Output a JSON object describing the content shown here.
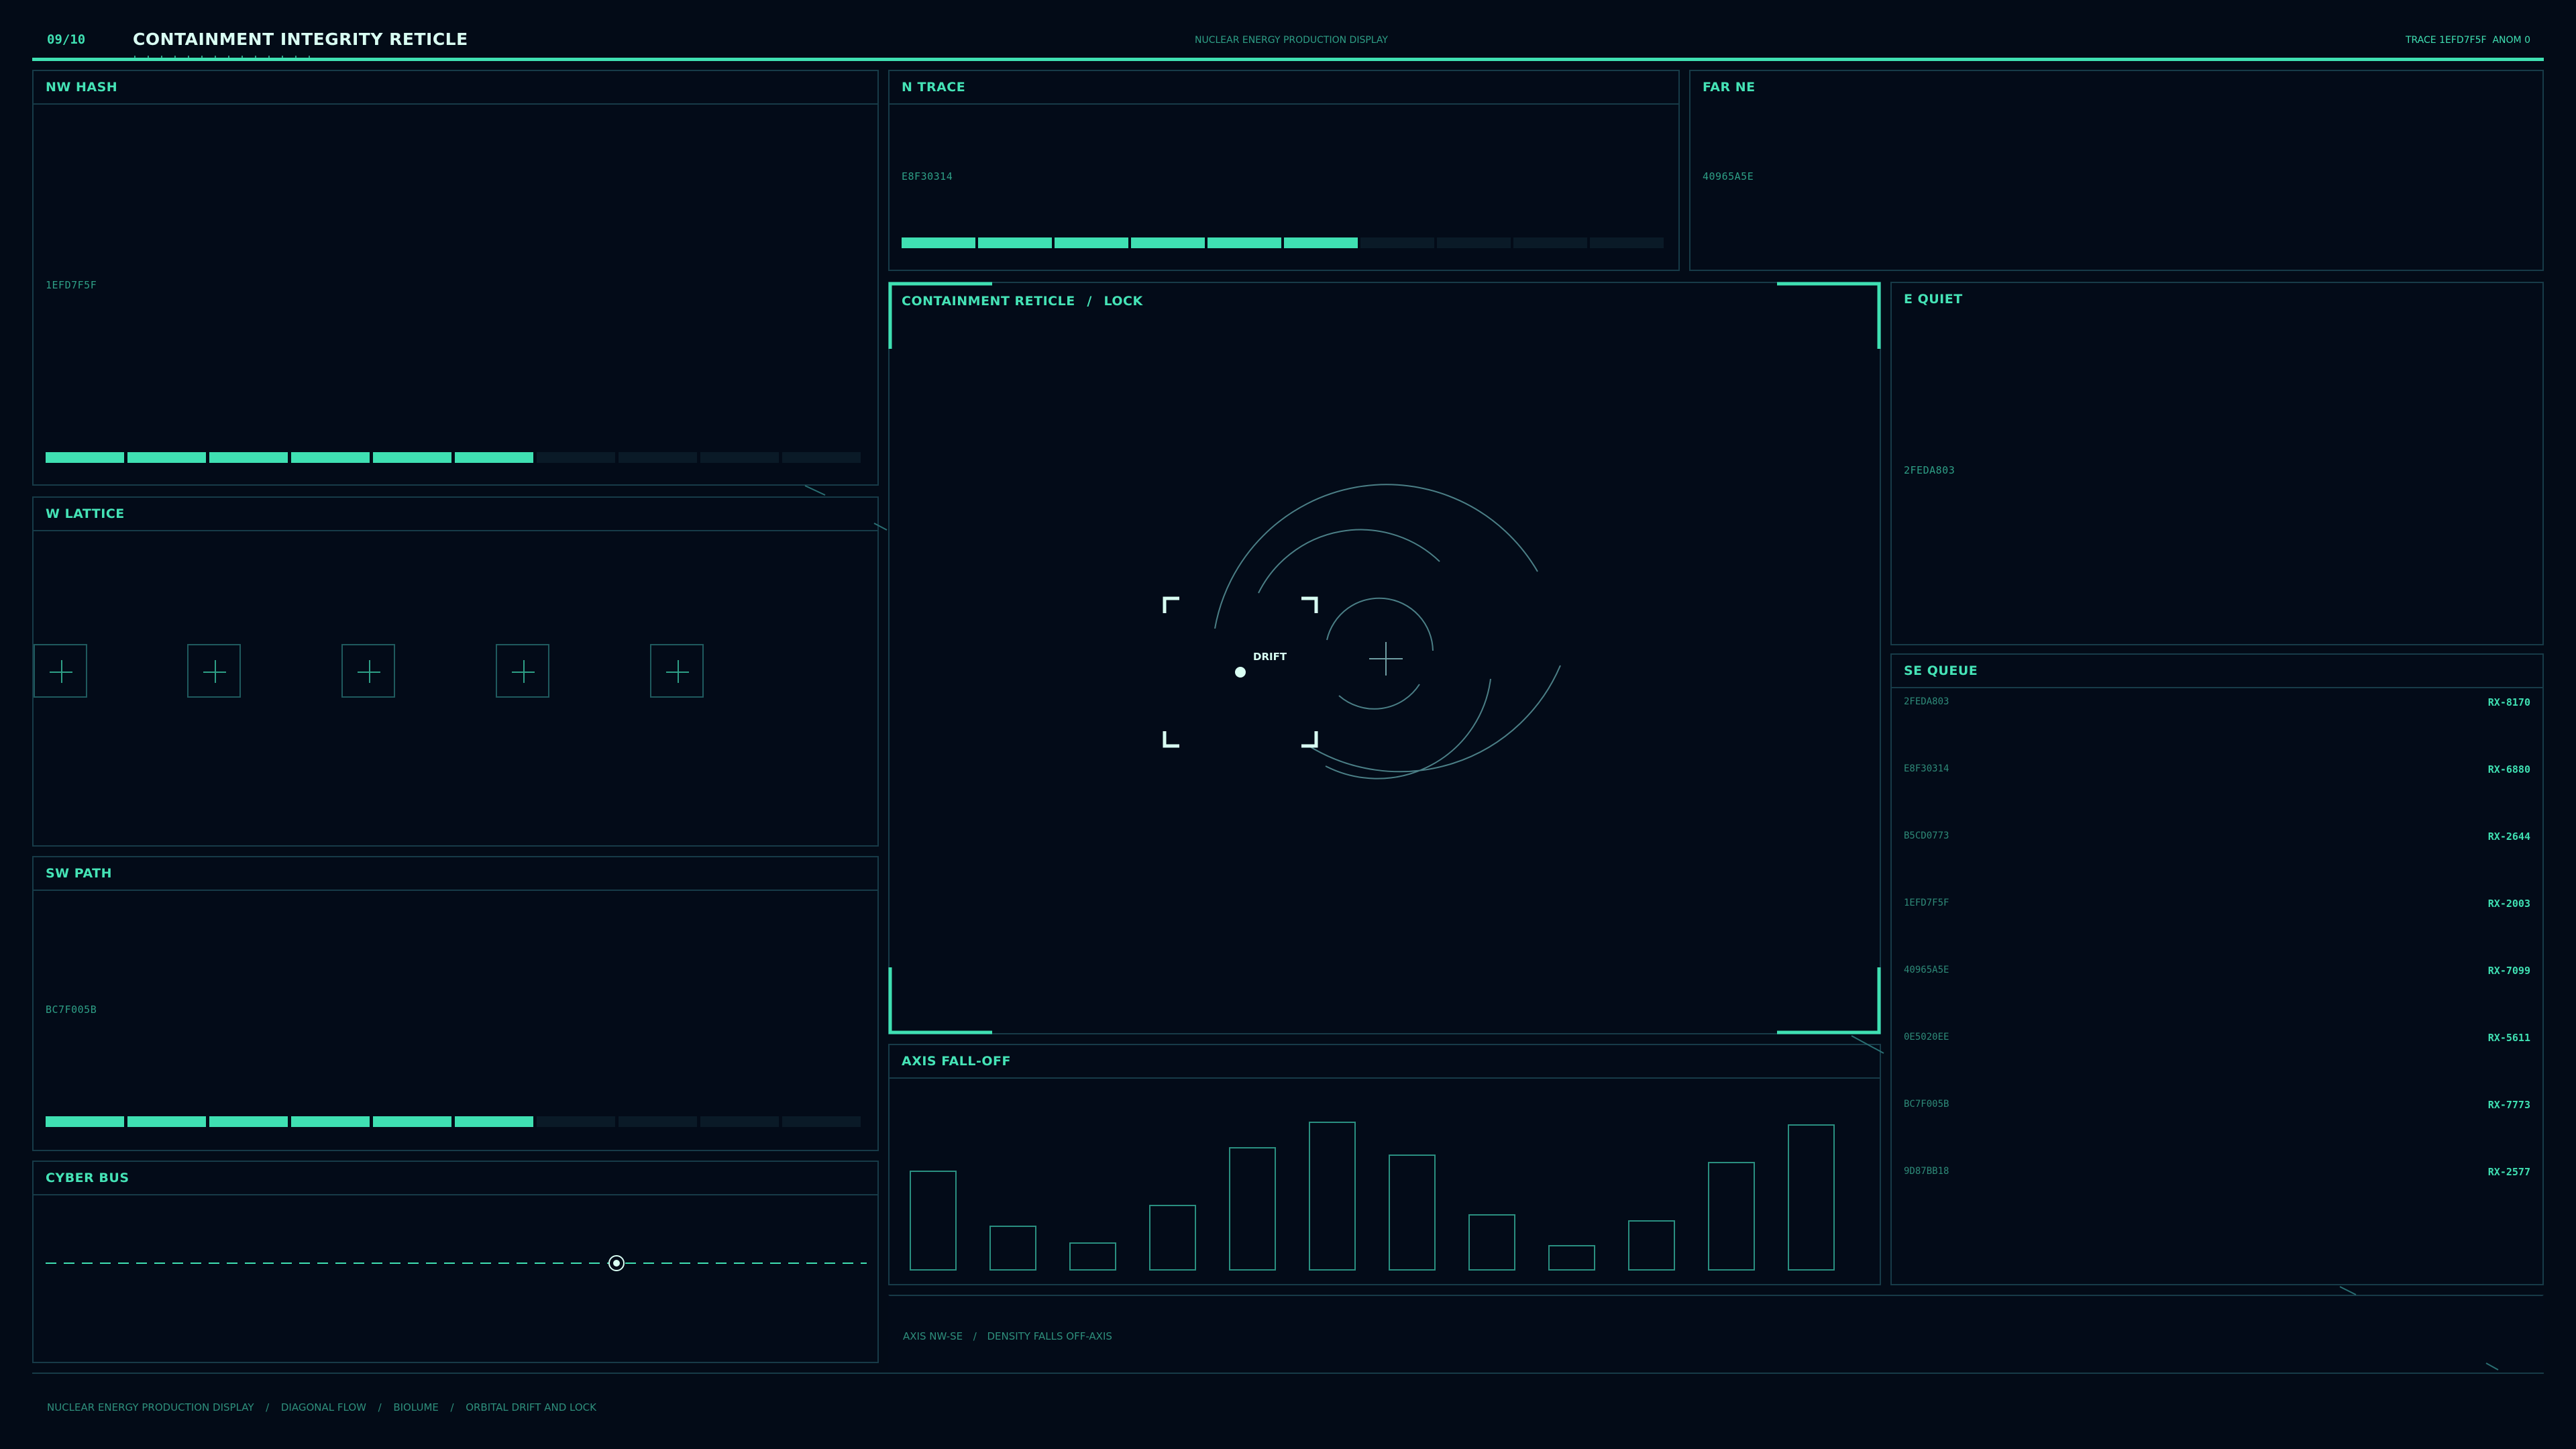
{
  "header": {
    "page_counter": "09/10",
    "title": "CONTAINMENT INTEGRITY RETICLE",
    "subtitle": "NUCLEAR ENERGY PRODUCTION DISPLAY",
    "trace": "TRACE 1EFD7F5F",
    "anom": "ANOM 0"
  },
  "panels": {
    "nw_hash": {
      "title": "NW HASH",
      "hex": "1EFD7F5F",
      "level": 0.6
    },
    "n_trace": {
      "title": "N TRACE",
      "hex": "E8F30314",
      "level": 0.6
    },
    "far_ne": {
      "title": "FAR NE",
      "hex": "40965A5E"
    },
    "w_lattice": {
      "title": "W LATTICE",
      "cells": 5
    },
    "sw_path": {
      "title": "SW PATH",
      "hex": "BC7F005B",
      "level": 0.6
    },
    "cyber_bus": {
      "title": "CYBER BUS",
      "marker_position": 0.7
    },
    "e_quiet": {
      "title": "E QUIET",
      "hex": "2FEDA803"
    },
    "reticle": {
      "title_a": "CONTAINMENT RETICLE",
      "sep": "/",
      "title_b": "LOCK",
      "drift_label": "DRIFT"
    },
    "axis_falloff": {
      "title": "AXIS FALL-OFF"
    }
  },
  "se_queue": {
    "title": "SE QUEUE",
    "rows": [
      {
        "id": "2FEDA803",
        "code": "RX-8170"
      },
      {
        "id": "E8F30314",
        "code": "RX-6880"
      },
      {
        "id": "B5CD0773",
        "code": "RX-2644"
      },
      {
        "id": "1EFD7F5F",
        "code": "RX-2003"
      },
      {
        "id": "40965A5E",
        "code": "RX-7099"
      },
      {
        "id": "0E5020EE",
        "code": "RX-5611"
      },
      {
        "id": "BC7F005B",
        "code": "RX-7773"
      },
      {
        "id": "9D87BB18",
        "code": "RX-2577"
      }
    ]
  },
  "axis_note": {
    "a": "AXIS NW-SE",
    "sep": "/",
    "b": "DENSITY FALLS OFF-AXIS"
  },
  "footer": {
    "a": "NUCLEAR ENERGY PRODUCTION DISPLAY",
    "b": "DIAGONAL FLOW",
    "c": "BIOLUME",
    "d": "ORBITAL DRIFT AND LOCK",
    "sep": "/"
  },
  "chart_data": {
    "type": "bar",
    "title": "AXIS FALL-OFF",
    "values": [
      0.67,
      0.3,
      0.19,
      0.44,
      0.83,
      1.0,
      0.78,
      0.38,
      0.17,
      0.34,
      0.73,
      0.98
    ],
    "ylim": [
      0,
      1
    ],
    "grid": false
  },
  "colors": {
    "background": "#030b17",
    "panel_border": "#173b48",
    "accent": "#3fe0b2",
    "accent_dim": "#2e9f86"
  }
}
